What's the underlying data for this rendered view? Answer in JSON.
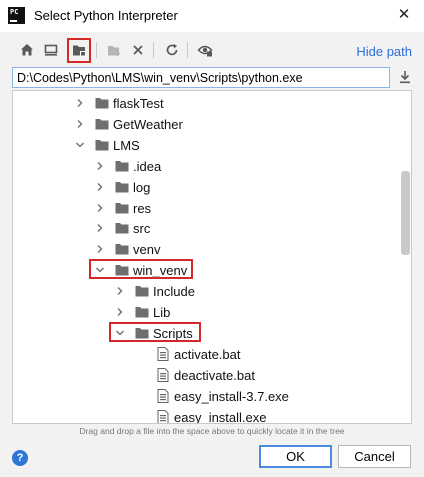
{
  "window": {
    "title": "Select Python Interpreter",
    "app_logo_text": "PC",
    "close_glyph": "✕"
  },
  "toolbar": {
    "buttons": [
      {
        "name": "home-icon",
        "enabled": true
      },
      {
        "name": "desktop-icon",
        "enabled": true
      },
      {
        "name": "project-folder-icon",
        "enabled": true
      },
      {
        "name": "new-folder-icon",
        "enabled": false
      },
      {
        "name": "delete-icon",
        "enabled": true
      },
      {
        "name": "refresh-icon",
        "enabled": true
      },
      {
        "name": "show-hidden-icon",
        "enabled": true
      }
    ],
    "hide_path_label": "Hide path"
  },
  "path": {
    "value": "D:\\Codes\\Python\\LMS\\win_venv\\Scripts\\python.exe"
  },
  "tree": {
    "items": [
      {
        "label": "flaskTest",
        "depth": 0,
        "type": "folder",
        "expanded": false
      },
      {
        "label": "GetWeather",
        "depth": 0,
        "type": "folder",
        "expanded": false
      },
      {
        "label": "LMS",
        "depth": 0,
        "type": "folder",
        "expanded": true
      },
      {
        "label": ".idea",
        "depth": 1,
        "type": "folder",
        "expanded": false
      },
      {
        "label": "log",
        "depth": 1,
        "type": "folder",
        "expanded": false
      },
      {
        "label": "res",
        "depth": 1,
        "type": "folder",
        "expanded": false
      },
      {
        "label": "src",
        "depth": 1,
        "type": "folder",
        "expanded": false
      },
      {
        "label": "venv",
        "depth": 1,
        "type": "folder",
        "expanded": false
      },
      {
        "label": "win_venv",
        "depth": 1,
        "type": "folder",
        "expanded": true
      },
      {
        "label": "Include",
        "depth": 2,
        "type": "folder",
        "expanded": false
      },
      {
        "label": "Lib",
        "depth": 2,
        "type": "folder",
        "expanded": false
      },
      {
        "label": "Scripts",
        "depth": 2,
        "type": "folder",
        "expanded": true
      },
      {
        "label": "activate.bat",
        "depth": 3,
        "type": "file"
      },
      {
        "label": "deactivate.bat",
        "depth": 3,
        "type": "file"
      },
      {
        "label": "easy_install-3.7.exe",
        "depth": 3,
        "type": "file"
      },
      {
        "label": "easy_install.exe",
        "depth": 3,
        "type": "file"
      }
    ]
  },
  "hint": "Drag and drop a file into the space above to quickly locate it in the tree",
  "footer": {
    "help_glyph": "?",
    "ok_label": "OK",
    "cancel_label": "Cancel"
  },
  "colors": {
    "accent": "#2a6fdb",
    "highlight": "#d62828",
    "folder": "#6e6e6e"
  }
}
